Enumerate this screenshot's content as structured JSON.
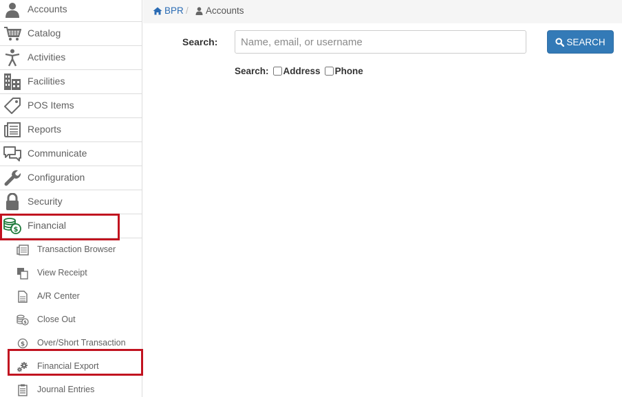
{
  "sidebar": {
    "items": [
      {
        "label": "Accounts",
        "icon": "user-icon"
      },
      {
        "label": "Catalog",
        "icon": "cart-icon"
      },
      {
        "label": "Activities",
        "icon": "person-icon"
      },
      {
        "label": "Facilities",
        "icon": "building-icon"
      },
      {
        "label": "POS Items",
        "icon": "tag-icon"
      },
      {
        "label": "Reports",
        "icon": "newspaper-icon"
      },
      {
        "label": "Communicate",
        "icon": "chat-icon"
      },
      {
        "label": "Configuration",
        "icon": "wrench-icon"
      },
      {
        "label": "Security",
        "icon": "lock-icon"
      },
      {
        "label": "Financial",
        "icon": "coins-icon"
      }
    ],
    "financial_submenu": [
      {
        "label": "Transaction Browser",
        "icon": "newspaper-icon"
      },
      {
        "label": "View Receipt",
        "icon": "copy-icon"
      },
      {
        "label": "A/R Center",
        "icon": "document-icon"
      },
      {
        "label": "Close Out",
        "icon": "coins-icon"
      },
      {
        "label": "Over/Short Transaction",
        "icon": "dollar-circle-icon"
      },
      {
        "label": "Financial Export",
        "icon": "gears-icon"
      },
      {
        "label": "Journal Entries",
        "icon": "list-icon"
      }
    ]
  },
  "breadcrumb": {
    "home": "BPR",
    "separator": "/",
    "current": "Accounts"
  },
  "search": {
    "label": "Search:",
    "placeholder": "Name, email, or username",
    "value": "",
    "button_label": "SEARCH",
    "options_label": "Search:",
    "options": [
      {
        "label": "Address",
        "checked": false
      },
      {
        "label": "Phone",
        "checked": false
      }
    ]
  },
  "colors": {
    "accent": "#337ab7",
    "link": "#2a6bb4",
    "highlight": "#c1121f",
    "financial_icon": "#1e7a3a"
  }
}
